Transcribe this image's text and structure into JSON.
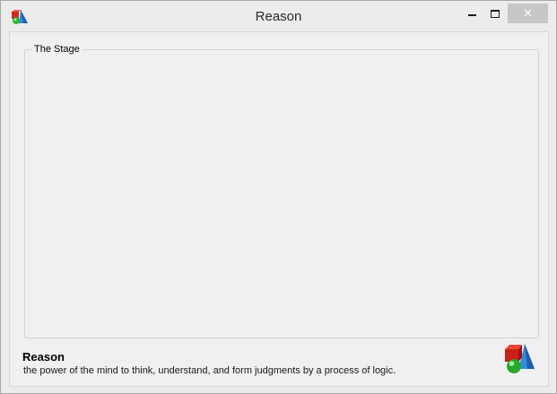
{
  "window": {
    "title": "Reason",
    "app_icon": "shapes-logo-icon",
    "controls": {
      "minimize_icon": "minimize-icon",
      "maximize_icon": "maximize-icon",
      "close_icon": "close-icon",
      "close_glyph": "✕"
    }
  },
  "stage": {
    "legend": "The Stage"
  },
  "footer": {
    "title": "Reason",
    "description": "the power of the mind to think, understand, and form judgments by a process of logic.",
    "icon": "shapes-logo-icon"
  },
  "colors": {
    "window_bg": "#ececec",
    "client_bg": "#f0f0f0",
    "close_button_bg": "#c7c7c7",
    "icon_red": "#d8261c",
    "icon_green": "#2fb82f",
    "icon_blue": "#2f8be0"
  }
}
